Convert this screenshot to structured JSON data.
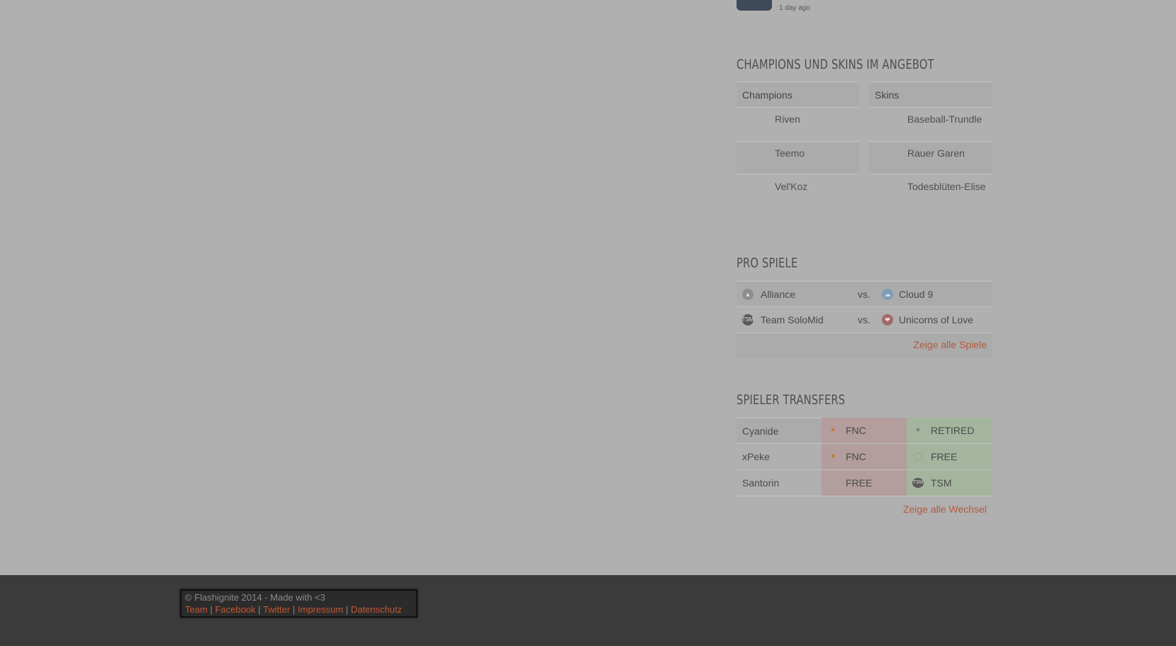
{
  "news": {
    "time": "1 day ago"
  },
  "champions_section": {
    "title": "CHAMPIONS UND SKINS IM ANGEBOT",
    "champions_header": "Champions",
    "skins_header": "Skins",
    "champions": [
      "Riven",
      "Teemo",
      "Vel'Koz"
    ],
    "skins": [
      "Baseball-Trundle",
      "Rauer Garen",
      "Todesblüten-Elise"
    ]
  },
  "pro_section": {
    "title": "PRO SPIELE",
    "vs_label": "vs.",
    "matches": [
      {
        "team1": "Alliance",
        "team1_icon": "alliance-logo-icon",
        "team2": "Cloud 9",
        "team2_icon": "cloud9-logo-icon"
      },
      {
        "team1": "Team SoloMid",
        "team1_icon": "tsm-logo-icon",
        "team2": "Unicorns of Love",
        "team2_icon": "uol-logo-icon"
      }
    ],
    "show_all": "Zeige alle Spiele"
  },
  "transfers_section": {
    "title": "SPIELER TRANSFERS",
    "rows": [
      {
        "player": "Cyanide",
        "from": "FNC",
        "from_icon": "fnatic-logo-icon",
        "to": "RETIRED",
        "to_icon": "retired-icon"
      },
      {
        "player": "xPeke",
        "from": "FNC",
        "from_icon": "fnatic-logo-icon",
        "to": "FREE",
        "to_icon": "free-agent-icon"
      },
      {
        "player": "Santorin",
        "from": "FREE",
        "from_icon": "free-agent-icon",
        "to": "TSM",
        "to_icon": "tsm-logo-icon"
      }
    ],
    "show_all": "Zeige alle Wechsel"
  },
  "footer": {
    "copyright": "© Flashignite 2014 - Made with <3",
    "links": [
      "Team",
      "Facebook",
      "Twitter",
      "Impressum",
      "Datenschutz"
    ],
    "separator": "|"
  },
  "colors": {
    "overlay": "#b0b0b0",
    "link": "#c65733",
    "loss_cell": "#b39d9d",
    "gain_cell": "#a4b49d",
    "footer_bg": "#3b3b3b"
  }
}
